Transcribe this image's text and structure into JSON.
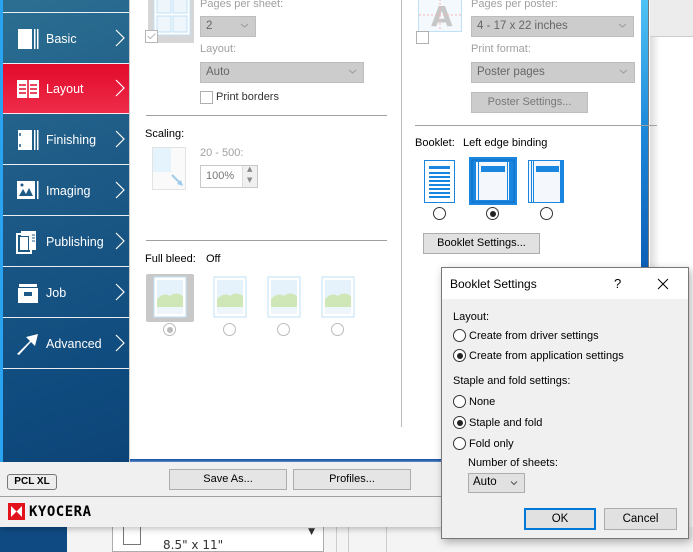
{
  "sidebar": {
    "items": [
      {
        "label": "Basic",
        "icon": "basic-icon",
        "active": false
      },
      {
        "label": "Layout",
        "icon": "layout-icon",
        "active": true
      },
      {
        "label": "Finishing",
        "icon": "finishing-icon",
        "active": false
      },
      {
        "label": "Imaging",
        "icon": "imaging-icon",
        "active": false
      },
      {
        "label": "Publishing",
        "icon": "publishing-icon",
        "active": false
      },
      {
        "label": "Job",
        "icon": "job-icon",
        "active": false
      },
      {
        "label": "Advanced",
        "icon": "advanced-icon",
        "active": false
      }
    ]
  },
  "multiup": {
    "pages_per_sheet_label": "Pages per sheet:",
    "pages_per_sheet_value": "2",
    "layout_label": "Layout:",
    "layout_value": "Auto",
    "print_borders_label": "Print borders",
    "enabled_checked": true
  },
  "poster": {
    "pages_per_poster_label": "Pages per poster:",
    "pages_per_poster_value": "4 - 17 x 22 inches",
    "print_format_label": "Print format:",
    "print_format_value": "Poster pages",
    "poster_settings_button": "Poster Settings...",
    "enabled_checked": false
  },
  "scaling": {
    "label": "Scaling:",
    "range_label": "20 - 500:",
    "value": "100%"
  },
  "booklet": {
    "label": "Booklet:",
    "value": "Left edge binding",
    "selected_index": 1,
    "settings_button": "Booklet Settings..."
  },
  "full_bleed": {
    "label": "Full bleed:",
    "value": "Off",
    "selected_index": 0
  },
  "footer": {
    "pcl_badge": "PCL XL",
    "save_as_button": "Save As...",
    "profiles_button": "Profiles...",
    "brand": "KYOCERA"
  },
  "background": {
    "paper_size": "8.5\" x 11\""
  },
  "booklet_dialog": {
    "title": "Booklet Settings",
    "help_label": "?",
    "layout_label": "Layout:",
    "layout_options": [
      {
        "label": "Create from driver settings",
        "checked": false
      },
      {
        "label": "Create from application settings",
        "checked": true
      }
    ],
    "staple_label": "Staple and fold settings:",
    "staple_options": [
      {
        "label": "None",
        "checked": false
      },
      {
        "label": "Staple and fold",
        "checked": true
      },
      {
        "label": "Fold only",
        "checked": false
      }
    ],
    "sheets_label": "Number of sheets:",
    "sheets_value": "Auto",
    "ok_button": "OK",
    "cancel_button": "Cancel"
  },
  "colors": {
    "active_tab": "#e20a2a",
    "sidebar": "#1d5a86",
    "accent_blue": "#0078d7"
  }
}
